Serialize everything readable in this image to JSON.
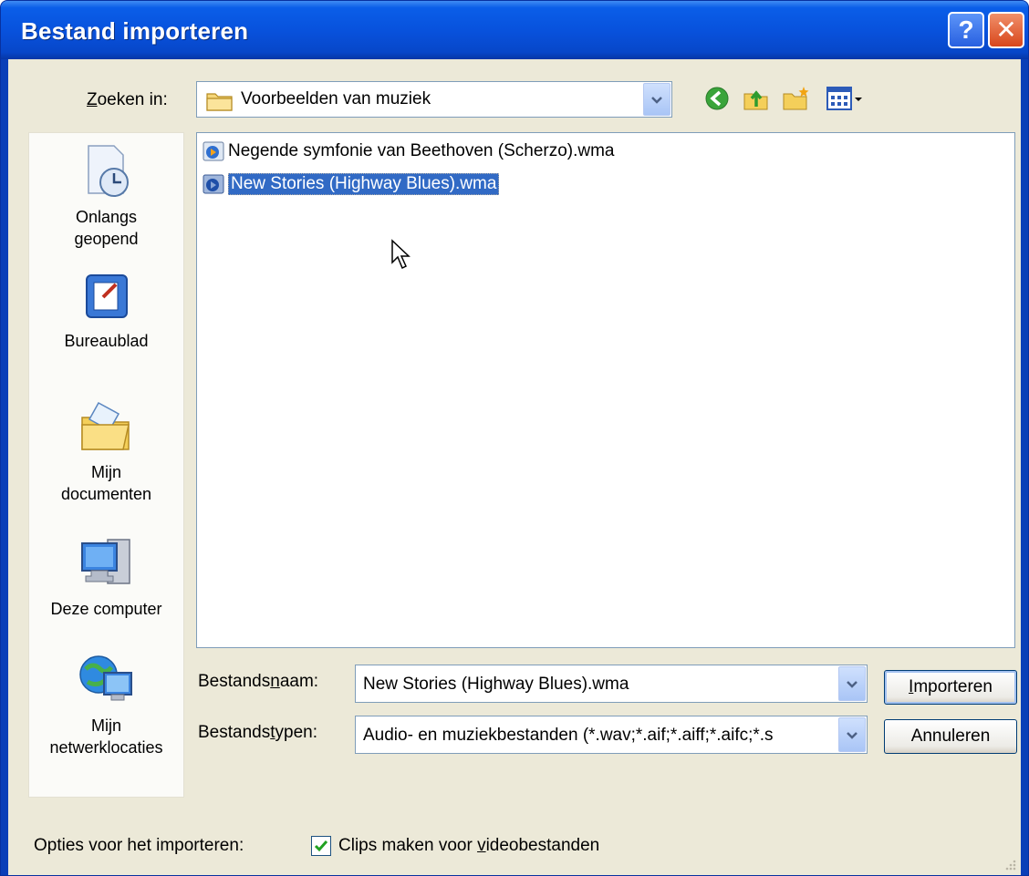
{
  "window": {
    "title": "Bestand importeren",
    "help_label": "?",
    "close_label": "✕"
  },
  "lookin": {
    "label_prefix": "",
    "label_key": "Z",
    "label_rest": "oeken in:",
    "value": "Voorbeelden van muziek",
    "folder_icon": "folder-icon"
  },
  "toolbar": {
    "back_icon": "back-arrow-icon",
    "up_icon": "up-folder-icon",
    "new_folder_icon": "new-folder-icon",
    "views_icon": "views-menu-icon"
  },
  "places": [
    {
      "label1": "Onlangs",
      "label2": "geopend",
      "icon": "recent-documents-icon"
    },
    {
      "label1": "Bureaublad",
      "label2": "",
      "icon": "desktop-icon"
    },
    {
      "label1": "Mijn",
      "label2": "documenten",
      "icon": "my-documents-icon"
    },
    {
      "label1": "Deze computer",
      "label2": "",
      "icon": "my-computer-icon"
    },
    {
      "label1": "Mijn",
      "label2": "netwerklocaties",
      "icon": "network-places-icon"
    }
  ],
  "files": [
    {
      "name": "Negende symfonie van Beethoven (Scherzo).wma",
      "selected": false,
      "icon": "wma-file-icon"
    },
    {
      "name": "New Stories (Highway Blues).wma",
      "selected": true,
      "icon": "wma-file-icon"
    }
  ],
  "filename": {
    "label_pre": "Bestands",
    "label_key": "n",
    "label_post": "aam:",
    "value": "New Stories (Highway Blues).wma"
  },
  "filetype": {
    "label_pre": "Bestands",
    "label_key": "t",
    "label_post": "ypen:",
    "value": "Audio- en muziekbestanden (*.wav;*.aif;*.aiff;*.aifc;*.s"
  },
  "buttons": {
    "import_key": "I",
    "import_rest": "mporteren",
    "cancel": "Annuleren"
  },
  "options": {
    "label": "Opties voor het importeren:",
    "checkbox_pre": "Clips maken voor ",
    "checkbox_key": "v",
    "checkbox_post": "ideobestanden",
    "checked": true
  }
}
